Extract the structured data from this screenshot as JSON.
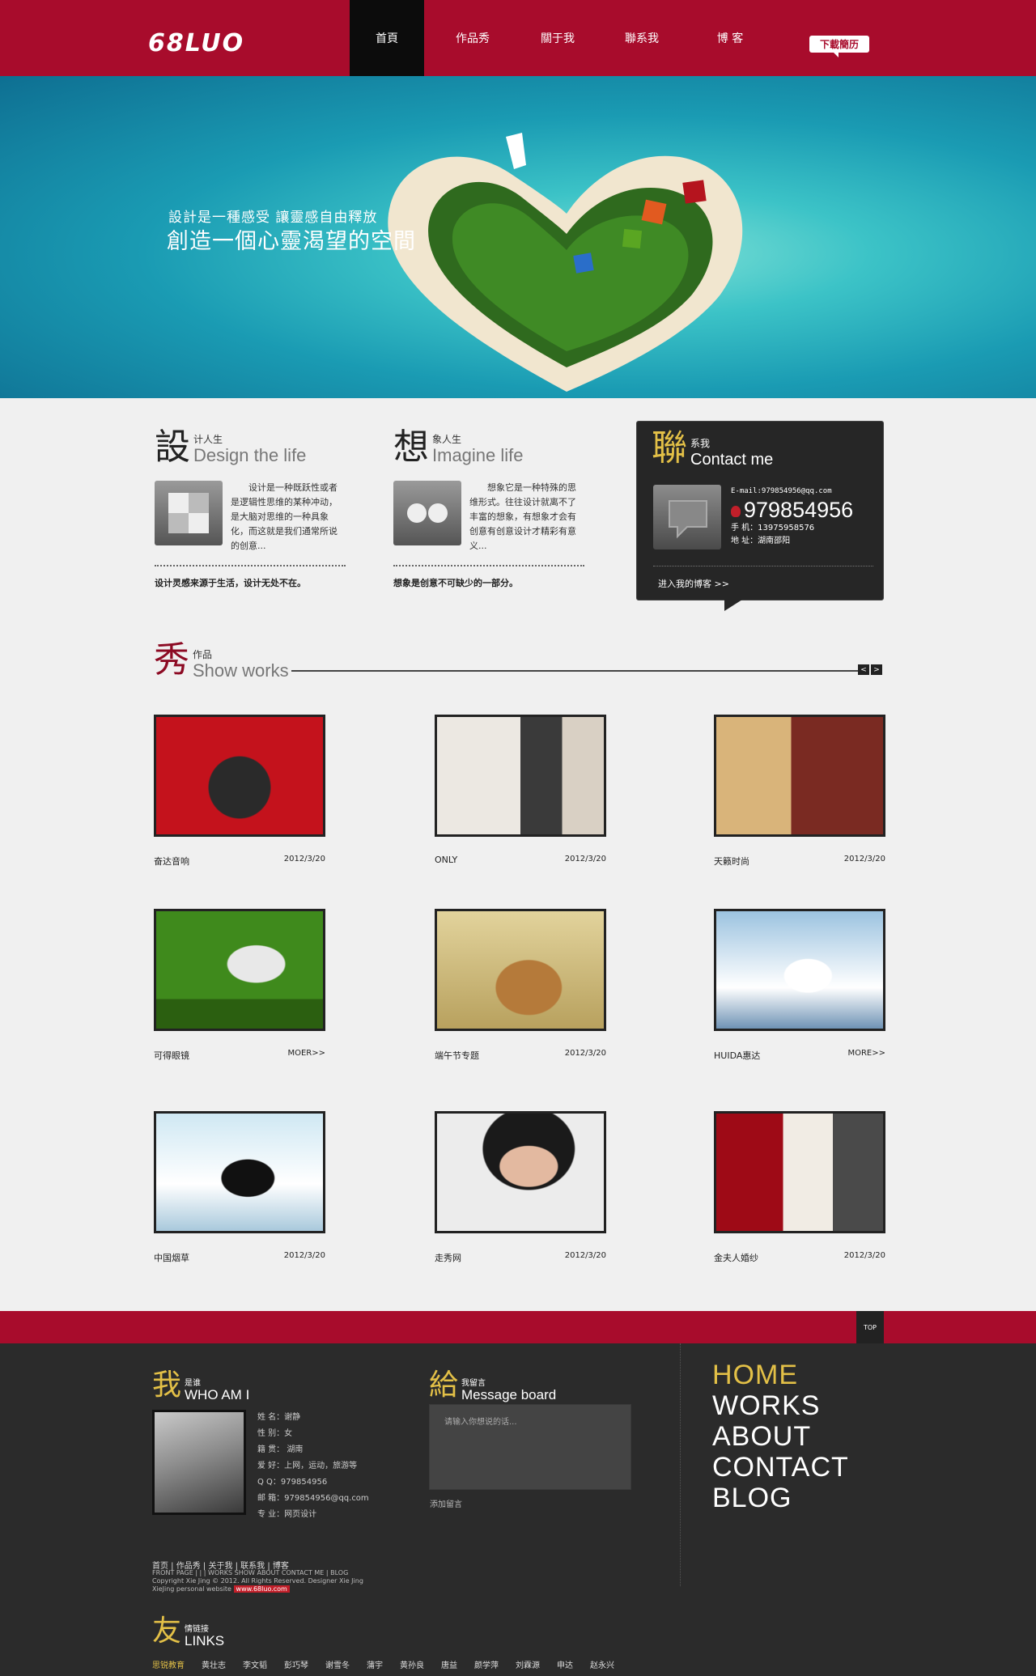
{
  "header": {
    "logo": "68LUO",
    "nav": [
      "首頁",
      "作品秀",
      "關于我",
      "聯系我",
      "博 客"
    ],
    "resume_button": "下載簡历"
  },
  "banner": {
    "line1": "設計是一種感受 讓靈感自由釋放",
    "line2": "創造一個心靈渴望的空間"
  },
  "intro": [
    {
      "char": "設",
      "small": "计人生",
      "eng": "Design the life",
      "text": "设计是一种既跃性或者是逻辑性思维的某种冲动，是大脑对思维的一种具象化，而这就是我们通常所说的创意...",
      "foot": "设计灵感来源于生活，设计无处不在。"
    },
    {
      "char": "想",
      "small": "象人生",
      "eng": "Imagine life",
      "text": "想象它是一种特殊的思维形式。往往设计就离不了丰富的想象，有想象才会有创意有创意设计才精彩有意义...",
      "foot": "想象是创意不可缺少的一部分。"
    }
  ],
  "contact": {
    "char": "聯",
    "small": "系我",
    "eng": "Contact me",
    "email": "E-mail:979854956@qq.com",
    "qq": "979854956",
    "phone": "手 机：13975958576",
    "address": "地 址：湖南邵阳",
    "blog_link": "进入我的博客 >>"
  },
  "works_section": {
    "char": "秀",
    "small": "作品",
    "eng": "Show works",
    "prev": "<",
    "next": ">"
  },
  "works": [
    {
      "title": "奋达音响",
      "meta": "2012/3/20",
      "color": "#c4121c"
    },
    {
      "title": "ONLY",
      "meta": "2012/3/20",
      "color": "#ece8e2"
    },
    {
      "title": "天籁时尚",
      "meta": "2012/3/20",
      "color": "#a97842"
    },
    {
      "title": "可得眼镜",
      "meta": "MOER>>",
      "color": "#3f8a1c"
    },
    {
      "title": "端午节专题",
      "meta": "2012/3/20",
      "color": "#c9b77e"
    },
    {
      "title": "HUIDA惠达",
      "meta": "MORE>>",
      "color": "#8fb6d6"
    },
    {
      "title": "中国烟草",
      "meta": "2012/3/20",
      "color": "#bfe0ef"
    },
    {
      "title": "走秀网",
      "meta": "2012/3/20",
      "color": "#e9e9e9"
    },
    {
      "title": "金夫人婚纱",
      "meta": "2012/3/20",
      "color": "#9e0a16"
    }
  ],
  "footer": {
    "top_button": "TOP",
    "who": {
      "char": "我",
      "small": "是谁",
      "eng": "WHO AM I",
      "info": [
        "姓 名：谢静",
        "性 别：女",
        "籍 贯： 湖南",
        "爱 好：上网，运动，旅游等",
        "Q Q：979854956",
        "邮 箱：979854956@qq.com",
        "专 业：网页设计"
      ]
    },
    "message": {
      "char": "給",
      "small": "我留言",
      "eng": "Message board",
      "placeholder": "请输入你想说的话...",
      "submit": "添加留言"
    },
    "big_nav": [
      "HOME",
      "WORKS",
      "ABOUT",
      "CONTACT",
      "BLOG"
    ],
    "bottom_nav": "首页 | 作品秀 | 关于我 | 联系我 | 博客",
    "copy_line1": "FRONT PAGE | | | WORKS SHOW ABOUT CONTACT ME | BLOG",
    "copy_line2": "Copyright Xie Jing © 2012. All Rights Reserved. Designer Xie Jing",
    "copy_line3": "XieJing personal website",
    "site": "www.68luo.com",
    "links": {
      "char": "友",
      "small": "情链接",
      "eng": "LINKS",
      "items": [
        "思锐教育",
        "黄壮志",
        "李文韬",
        "彭巧琴",
        "谢雪冬",
        "蒲宇",
        "黄孙良",
        "唐益",
        "颜学萍",
        "刘霖源",
        "申达",
        "赵永兴"
      ]
    }
  },
  "colors": {
    "brand_red": "#a80c2c",
    "accent_gold": "#e3c047",
    "dark": "#2b2b2b"
  }
}
